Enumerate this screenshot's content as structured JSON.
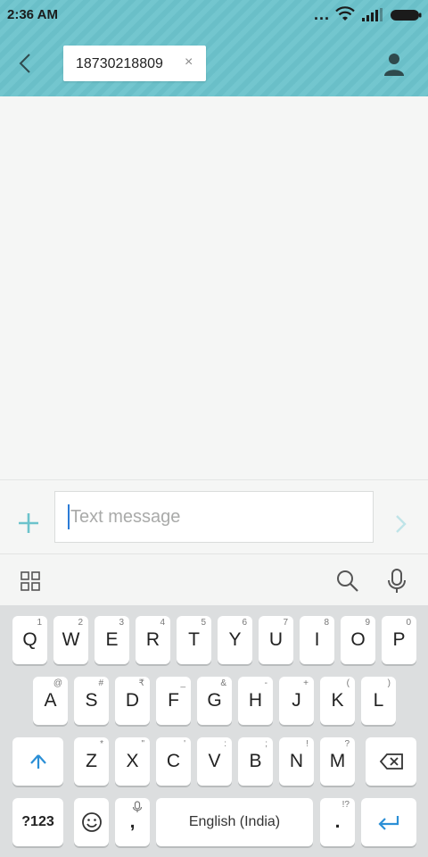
{
  "status": {
    "time": "2:36 AM",
    "overflow": "..."
  },
  "header": {
    "recipient": "18730218809",
    "remove_glyph": "×"
  },
  "compose": {
    "placeholder": "Text message"
  },
  "keyboard": {
    "row1": [
      {
        "label": "Q",
        "hint": "1"
      },
      {
        "label": "W",
        "hint": "2"
      },
      {
        "label": "E",
        "hint": "3"
      },
      {
        "label": "R",
        "hint": "4"
      },
      {
        "label": "T",
        "hint": "5"
      },
      {
        "label": "Y",
        "hint": "6"
      },
      {
        "label": "U",
        "hint": "7"
      },
      {
        "label": "I",
        "hint": "8"
      },
      {
        "label": "O",
        "hint": "9"
      },
      {
        "label": "P",
        "hint": "0"
      }
    ],
    "row2": [
      {
        "label": "A",
        "hint": "@"
      },
      {
        "label": "S",
        "hint": "#"
      },
      {
        "label": "D",
        "hint": "₹"
      },
      {
        "label": "F",
        "hint": "_"
      },
      {
        "label": "G",
        "hint": "&"
      },
      {
        "label": "H",
        "hint": "-"
      },
      {
        "label": "J",
        "hint": "+"
      },
      {
        "label": "K",
        "hint": "("
      },
      {
        "label": "L",
        "hint": ")"
      }
    ],
    "row3": [
      {
        "label": "Z",
        "hint": "*"
      },
      {
        "label": "X",
        "hint": "\""
      },
      {
        "label": "C",
        "hint": "'"
      },
      {
        "label": "V",
        "hint": ":"
      },
      {
        "label": "B",
        "hint": ";"
      },
      {
        "label": "N",
        "hint": "!"
      },
      {
        "label": "M",
        "hint": "?"
      }
    ],
    "symbols_label": "?123",
    "comma_label": ",",
    "space_label": "English (India)",
    "period_label": ".",
    "period_hint": "!?"
  },
  "colors": {
    "header": "#6cc3cc",
    "accent": "#6cc3cc",
    "caret": "#2b7bd6",
    "enter": "#2b8fd6"
  },
  "icons": [
    "back-icon",
    "person-icon",
    "plus-icon",
    "send-icon",
    "grid-icon",
    "search-icon",
    "mic-icon",
    "shift-icon",
    "backspace-icon",
    "emoji-icon",
    "enter-icon"
  ]
}
